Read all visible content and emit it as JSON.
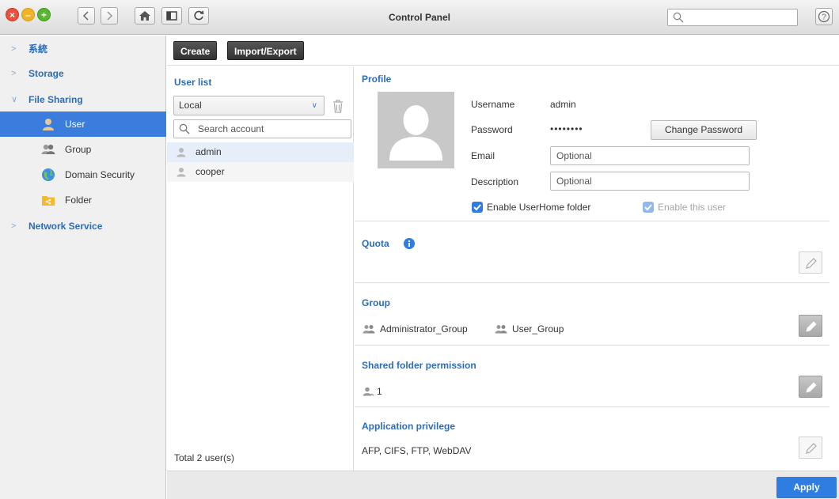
{
  "window": {
    "title": "Control Panel",
    "search_placeholder": "",
    "help_label": "?"
  },
  "sidebar": {
    "categories": [
      {
        "label": "系統"
      },
      {
        "label": "Storage"
      },
      {
        "label": "File Sharing"
      },
      {
        "label": "Network Service"
      }
    ],
    "items": [
      {
        "label": "User",
        "icon": "user-icon"
      },
      {
        "label": "Group",
        "icon": "group-icon"
      },
      {
        "label": "Domain Security",
        "icon": "globe-icon"
      },
      {
        "label": "Folder",
        "icon": "folder-icon"
      }
    ]
  },
  "toolbar": {
    "create_label": "Create",
    "import_export_label": "Import/Export"
  },
  "user_list": {
    "title": "User list",
    "source_selected": "Local",
    "search_placeholder": "Search account",
    "users": [
      "admin",
      "cooper"
    ],
    "total": "Total 2 user(s)"
  },
  "profile": {
    "title": "Profile",
    "username_label": "Username",
    "username_value": "admin",
    "password_label": "Password",
    "password_value": "••••••••",
    "change_password_label": "Change Password",
    "email_label": "Email",
    "email_placeholder": "Optional",
    "description_label": "Description",
    "description_placeholder": "Optional",
    "enable_userhome_label": "Enable UserHome folder",
    "enable_user_label": "Enable this user"
  },
  "quota": {
    "title": "Quota"
  },
  "group": {
    "title": "Group",
    "groups": [
      "Administrator_Group",
      "User_Group"
    ]
  },
  "shared_folder": {
    "title": "Shared folder permission",
    "count": "1"
  },
  "app_privilege": {
    "title": "Application privilege",
    "value": "AFP, CIFS, FTP, WebDAV"
  },
  "footer": {
    "apply_label": "Apply"
  },
  "colors": {
    "accent": "#2f7de1",
    "sidebar_active": "#3b7ddd",
    "heading": "#2d6cb8"
  }
}
